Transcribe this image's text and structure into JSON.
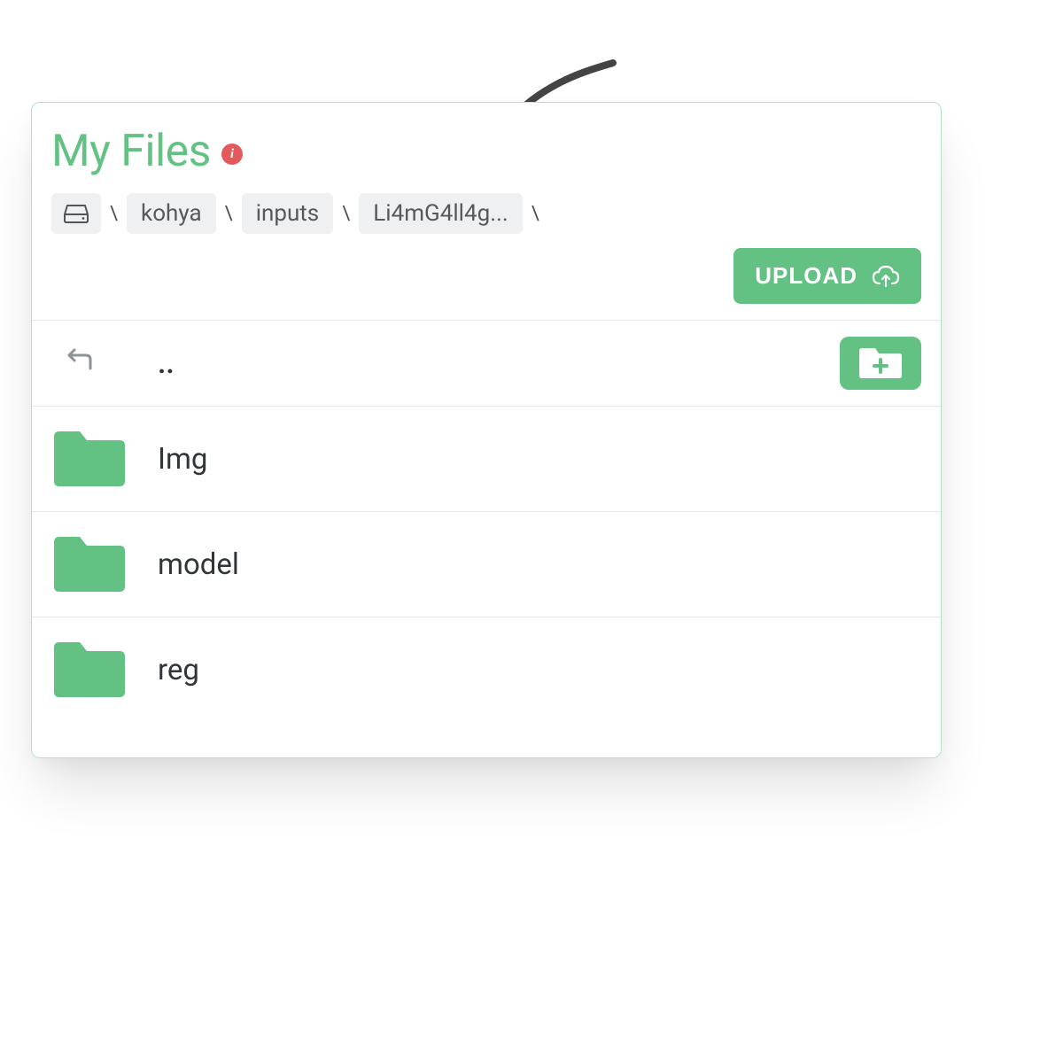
{
  "header": {
    "title": "My Files",
    "info_icon": "info-icon"
  },
  "breadcrumb": {
    "root_icon": "drive-icon",
    "items": [
      {
        "label": "kohya"
      },
      {
        "label": "inputs"
      },
      {
        "label": "Li4mG4ll4g..."
      }
    ],
    "separator": "\\"
  },
  "actions": {
    "upload_label": "UPLOAD",
    "upload_icon": "cloud-upload-icon",
    "new_folder_icon": "new-folder-icon"
  },
  "parent_row": {
    "label": "..",
    "icon": "back-arrow-icon"
  },
  "folders": [
    {
      "name": "Img"
    },
    {
      "name": "model"
    },
    {
      "name": "reg"
    }
  ],
  "colors": {
    "accent": "#63c184",
    "danger": "#e35a5d",
    "crumb_bg": "#eef0f1",
    "text": "#303538",
    "muted": "#555a5f",
    "border": "#e6e6e6"
  }
}
